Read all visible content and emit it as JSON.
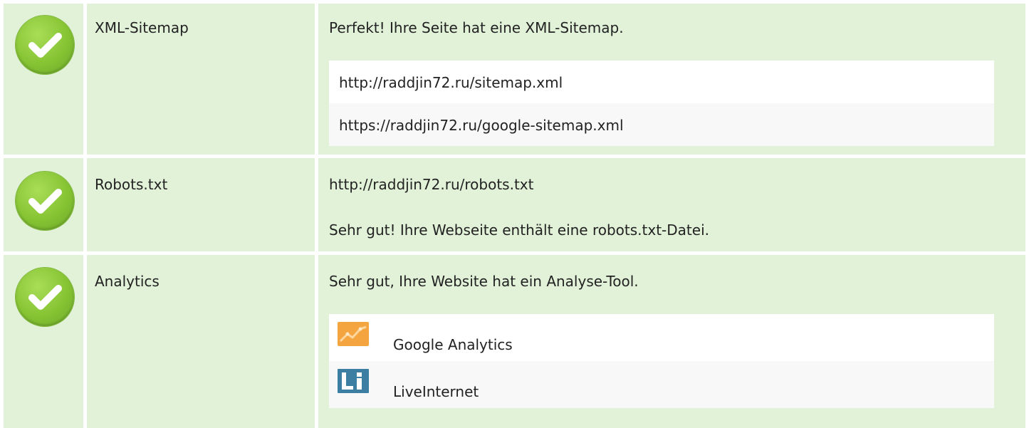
{
  "rows": [
    {
      "label": "XML-Sitemap",
      "message": "Perfekt! Ihre Seite hat eine XML-Sitemap.",
      "links": [
        "http://raddjin72.ru/sitemap.xml",
        "https://raddjin72.ru/google-sitemap.xml"
      ]
    },
    {
      "label": "Robots.txt",
      "url": "http://raddjin72.ru/robots.txt",
      "message": "Sehr gut! Ihre Webseite enthält eine robots.txt-Datei."
    },
    {
      "label": "Analytics",
      "message": "Sehr gut, Ihre Website hat ein Analyse-Tool.",
      "tools": [
        {
          "name": "Google Analytics",
          "icon": "google-analytics-icon"
        },
        {
          "name": "LiveInternet",
          "icon": "liveinternet-icon"
        }
      ]
    }
  ],
  "colors": {
    "cell_bg": "#e2f2d9",
    "check_green": "#86c433",
    "ga_orange": "#f4a540",
    "li_blue": "#3d7fa2"
  }
}
